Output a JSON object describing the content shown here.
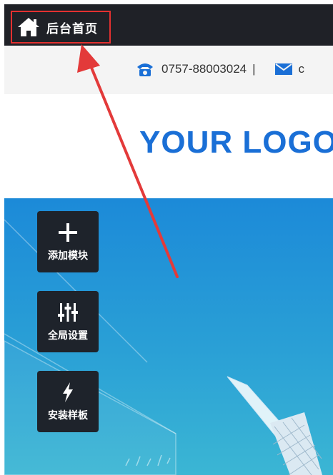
{
  "topbar": {
    "home_label": "后台首页"
  },
  "contact": {
    "phone": "0757-88003024",
    "separator": "|",
    "email_partial": "c"
  },
  "logo": {
    "text": "YOUR LOGO"
  },
  "tools": [
    {
      "label": "添加模块",
      "icon": "plus-icon"
    },
    {
      "label": "全局设置",
      "icon": "sliders-icon"
    },
    {
      "label": "安装样板",
      "icon": "lightning-icon"
    }
  ],
  "colors": {
    "topbar_bg": "#1f2127",
    "highlight_border": "#e33030",
    "arrow": "#e33a3a",
    "logo": "#1a6fd6",
    "hero_top": "#1c8ad8",
    "hero_bottom": "#3bb6d4",
    "tool_bg": "#1e232b"
  }
}
